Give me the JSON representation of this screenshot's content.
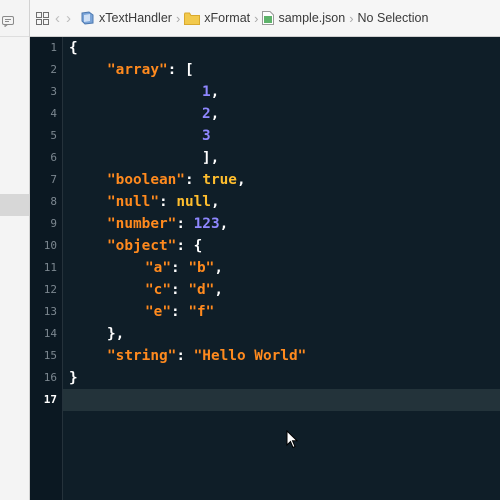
{
  "jumpbar": {
    "project": "xTextHandler",
    "folder": "xFormat",
    "file": "sample.json",
    "selection": "No Selection",
    "separator": "›",
    "back_glyph": "‹",
    "forward_glyph": "›"
  },
  "gutter": {
    "line_numbers": [
      "1",
      "2",
      "3",
      "4",
      "5",
      "6",
      "7",
      "8",
      "9",
      "10",
      "11",
      "12",
      "13",
      "14",
      "15",
      "16",
      "17"
    ],
    "active_line": "17"
  },
  "code": {
    "l1_brace": "{",
    "l2_key": "\"array\"",
    "l2_punct": ": [",
    "l3_val": "1",
    "l3_punct": ",",
    "l4_val": "2",
    "l4_punct": ",",
    "l5_val": "3",
    "l6_punct": "],",
    "l7_key": "\"boolean\"",
    "l7_colon": ": ",
    "l7_val": "true",
    "l7_comma": ",",
    "l8_key": "\"null\"",
    "l8_colon": ": ",
    "l8_val": "null",
    "l8_comma": ",",
    "l9_key": "\"number\"",
    "l9_colon": ": ",
    "l9_val": "123",
    "l9_comma": ",",
    "l10_key": "\"object\"",
    "l10_punct": ": {",
    "l11_key": "\"a\"",
    "l11_colon": ": ",
    "l11_val": "\"b\"",
    "l11_comma": ",",
    "l12_key": "\"c\"",
    "l12_colon": ": ",
    "l12_val": "\"d\"",
    "l12_comma": ",",
    "l13_key": "\"e\"",
    "l13_colon": ": ",
    "l13_val": "\"f\"",
    "l14_punct": "},",
    "l15_key": "\"string\"",
    "l15_colon": ": ",
    "l15_val": "\"Hello World\"",
    "l16_brace": "}"
  },
  "colors": {
    "editor_bg": "#0f1e28",
    "key_string": "#ff8a1e",
    "number": "#8f87ff",
    "keyword": "#ffbe2e"
  },
  "icons": [
    "comment-icon",
    "grid-icon",
    "project-icon",
    "folder-icon",
    "json-file-icon",
    "mouse-pointer-icon"
  ]
}
